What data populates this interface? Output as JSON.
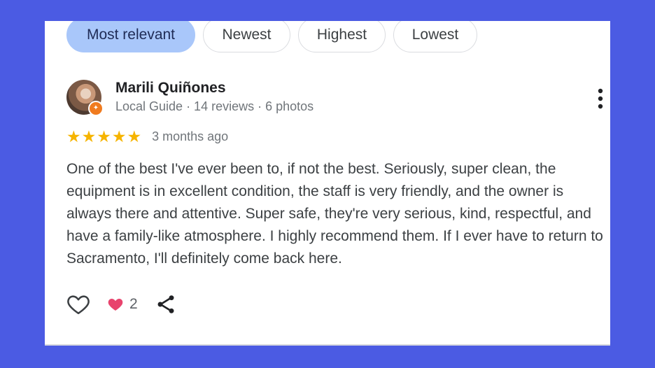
{
  "filters": [
    {
      "label": "Most relevant",
      "active": true
    },
    {
      "label": "Newest",
      "active": false
    },
    {
      "label": "Highest",
      "active": false
    },
    {
      "label": "Lowest",
      "active": false
    }
  ],
  "review": {
    "name": "Marili Quiñones",
    "meta": "Local Guide · 14 reviews · 6 photos",
    "rating_stars": "★★★★★",
    "rating_value": 5,
    "time_ago": "3 months ago",
    "text": "One of the best I've ever been to, if not the best. Seriously, super clean, the equipment is in excellent condition, the staff is very friendly, and the owner is always there and attentive. Super safe, they're very serious, kind, respectful, and have a family-like atmosphere. I highly recommend them. If I ever have to return to Sacramento, I'll definitely come back here.",
    "likes": "2"
  },
  "icons": {
    "badge": "local-guide-badge-icon",
    "menu": "more-vert-icon",
    "like": "heart-outline-icon",
    "liked": "heart-filled-icon",
    "share": "share-icon"
  },
  "colors": {
    "background": "#4b5be3",
    "chip_active": "#a9c7fa",
    "star": "#f6b400",
    "liked_heart": "#e8436d",
    "badge": "#f07b1f"
  }
}
